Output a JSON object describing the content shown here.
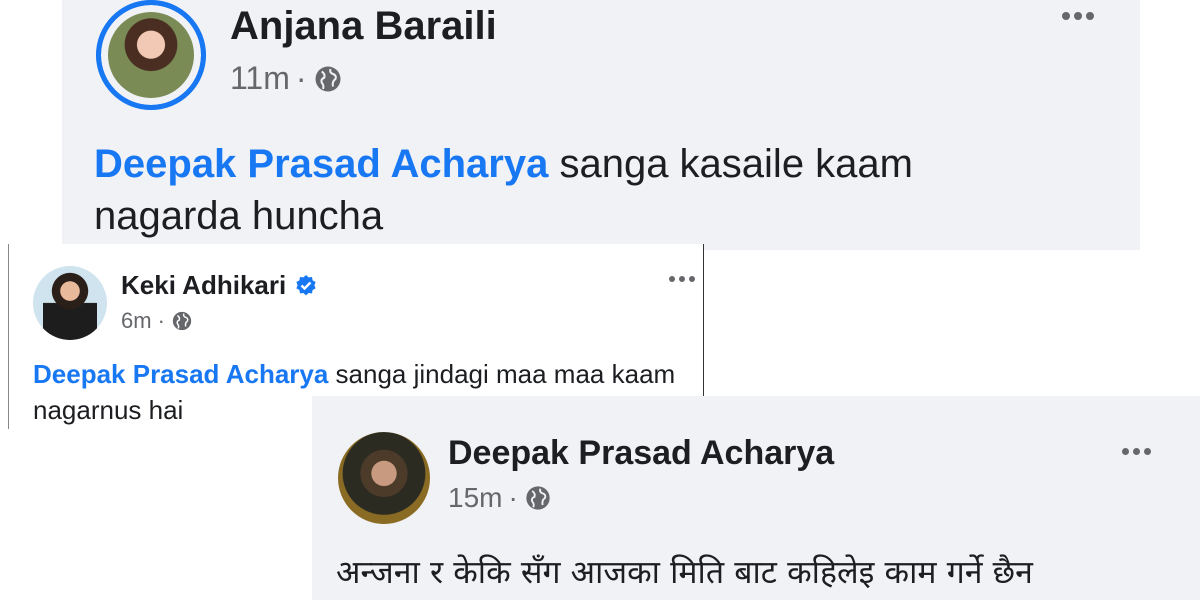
{
  "posts": [
    {
      "author": "Anjana Baraili",
      "time": "11m",
      "separator": "·",
      "privacy_icon": "globe-icon",
      "mention": "Deepak Prasad Acharya",
      "text": " sanga kasaile kaam nagarda huncha"
    },
    {
      "author": "Keki Adhikari",
      "verified_icon": "verified-badge-icon",
      "time": "6m",
      "separator": "·",
      "privacy_icon": "globe-icon",
      "mention": "Deepak Prasad Acharya",
      "text": " sanga jindagi maa maa kaam nagarnus hai"
    },
    {
      "author": "Deepak Prasad Acharya",
      "time": "15m",
      "separator": "·",
      "privacy_icon": "globe-icon",
      "text": "अन्जना र केकि सँग आजका मिति बाट कहिलेइ काम गर्ने छैन"
    }
  ],
  "colors": {
    "mention": "#1877f2",
    "card_background": "#f0f2f5",
    "meta_text": "#65676b"
  }
}
